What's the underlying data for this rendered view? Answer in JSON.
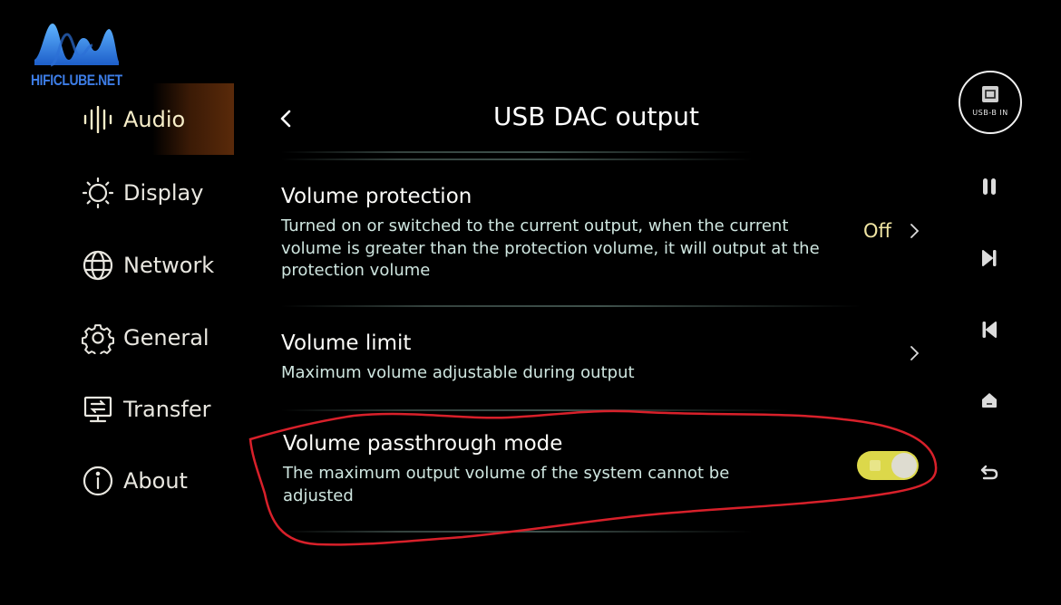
{
  "watermark": {
    "text": "HIFICLUBE.NET"
  },
  "sidebar": {
    "items": [
      {
        "label": "Audio",
        "icon": "sound-wave-icon",
        "active": true
      },
      {
        "label": "Display",
        "icon": "sun-icon",
        "active": false
      },
      {
        "label": "Network",
        "icon": "globe-icon",
        "active": false
      },
      {
        "label": "General",
        "icon": "gear-icon",
        "active": false
      },
      {
        "label": "Transfer",
        "icon": "monitor-transfer-icon",
        "active": false
      },
      {
        "label": "About",
        "icon": "info-icon",
        "active": false
      }
    ]
  },
  "header": {
    "title": "USB DAC output",
    "back_icon": "chevron-left-icon"
  },
  "settings": [
    {
      "title": "Volume protection",
      "description": "Turned on or switched to the current output, when the current volume is greater than the protection volume, it will output at the protection volume",
      "value": "Off",
      "control": "chevron-right-icon"
    },
    {
      "title": "Volume limit",
      "description": "Maximum volume adjustable during output",
      "control": "chevron-right-icon"
    },
    {
      "title": "Volume passthrough mode",
      "description": "The maximum output volume of the system cannot be adjusted",
      "control": "toggle",
      "toggle_on": true
    }
  ],
  "rail": {
    "source_label": "USB-B IN",
    "buttons": [
      "pause-icon",
      "skip-next-icon",
      "skip-previous-icon",
      "home-icon",
      "back-arrow-icon"
    ]
  },
  "colors": {
    "background": "#000000",
    "active_text": "#f7eec9",
    "value_text": "#efe4a2",
    "toggle_on": "#dcd84a",
    "description_text": "#cfe6e0",
    "annotation": "#d8202a",
    "watermark": "#3d7de6"
  }
}
